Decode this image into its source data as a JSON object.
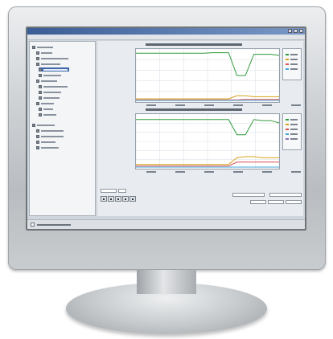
{
  "monitor": {
    "bezel_color": "#c9ccce",
    "screen_color": "#cfd6de"
  },
  "window": {
    "titlebar_color": "#3a5d96"
  },
  "tree": {
    "items": [
      {
        "indent": 0,
        "w": 20
      },
      {
        "indent": 4,
        "w": 14
      },
      {
        "indent": 4,
        "w": 34
      },
      {
        "indent": 4,
        "w": 24
      },
      {
        "indent": 6,
        "w": 30,
        "selected": true
      },
      {
        "indent": 6,
        "w": 22
      },
      {
        "indent": 4,
        "w": 20
      },
      {
        "indent": 6,
        "w": 30
      },
      {
        "indent": 6,
        "w": 22
      },
      {
        "indent": 6,
        "w": 20
      },
      {
        "indent": 4,
        "w": 16
      },
      {
        "indent": 6,
        "w": 12
      },
      {
        "indent": 6,
        "w": 16
      },
      {
        "indent": 0,
        "w": 22
      },
      {
        "indent": 4,
        "w": 28
      },
      {
        "indent": 4,
        "w": 28
      },
      {
        "indent": 4,
        "w": 18
      },
      {
        "indent": 4,
        "w": 22
      }
    ]
  },
  "charts": [
    {
      "x_ticks": 6,
      "y_ticks": 5,
      "series": [
        {
          "color": "#2f9a3a",
          "values": [
            0.92,
            0.92,
            0.92,
            0.92,
            0.92,
            0.92,
            0.92,
            0.92,
            0.92,
            0.93,
            0.93,
            0.93,
            0.5,
            0.5,
            0.9,
            0.9,
            0.9,
            0.88
          ]
        },
        {
          "color": "#d9a21b",
          "values": [
            0.06,
            0.06,
            0.06,
            0.06,
            0.06,
            0.06,
            0.06,
            0.06,
            0.06,
            0.06,
            0.06,
            0.06,
            0.12,
            0.12,
            0.1,
            0.1,
            0.1,
            0.1
          ]
        },
        {
          "color": "#d95050",
          "values": [
            0.04,
            0.04,
            0.04,
            0.04,
            0.04,
            0.04,
            0.04,
            0.04,
            0.04,
            0.04,
            0.04,
            0.04,
            0.04,
            0.05,
            0.05,
            0.05,
            0.05,
            0.05
          ]
        },
        {
          "color": "#45a7d9",
          "values": [
            0.03,
            0.03,
            0.03,
            0.03,
            0.03,
            0.03,
            0.03,
            0.03,
            0.03,
            0.03,
            0.03,
            0.03,
            0.03,
            0.03,
            0.03,
            0.03,
            0.03,
            0.03
          ]
        }
      ],
      "legend_colors": [
        "#2f9a3a",
        "#d9a21b",
        "#d95050",
        "#45a7d9"
      ]
    },
    {
      "x_ticks": 6,
      "y_ticks": 6,
      "series": [
        {
          "color": "#2f9a3a",
          "values": [
            0.9,
            0.9,
            0.9,
            0.9,
            0.9,
            0.9,
            0.9,
            0.9,
            0.9,
            0.9,
            0.9,
            0.9,
            0.62,
            0.62,
            0.9,
            0.88,
            0.88,
            0.84
          ]
        },
        {
          "color": "#d9a21b",
          "values": [
            0.08,
            0.08,
            0.08,
            0.08,
            0.08,
            0.08,
            0.08,
            0.08,
            0.08,
            0.08,
            0.08,
            0.08,
            0.2,
            0.22,
            0.22,
            0.2,
            0.2,
            0.2
          ]
        },
        {
          "color": "#d95050",
          "values": [
            0.05,
            0.05,
            0.05,
            0.05,
            0.05,
            0.05,
            0.05,
            0.05,
            0.05,
            0.05,
            0.05,
            0.05,
            0.12,
            0.12,
            0.12,
            0.12,
            0.12,
            0.12
          ]
        },
        {
          "color": "#45a7d9",
          "values": [
            0.03,
            0.03,
            0.03,
            0.03,
            0.03,
            0.03,
            0.03,
            0.03,
            0.03,
            0.03,
            0.03,
            0.03,
            0.03,
            0.03,
            0.03,
            0.03,
            0.03,
            0.03
          ]
        }
      ],
      "legend_colors": [
        "#2f9a3a",
        "#d9a21b",
        "#d95050",
        "#45a7d9",
        "#8c6fb8"
      ]
    }
  ],
  "icons": [
    "play-icon",
    "pause-icon",
    "step-forward-icon",
    "stop-icon",
    "record-icon"
  ]
}
